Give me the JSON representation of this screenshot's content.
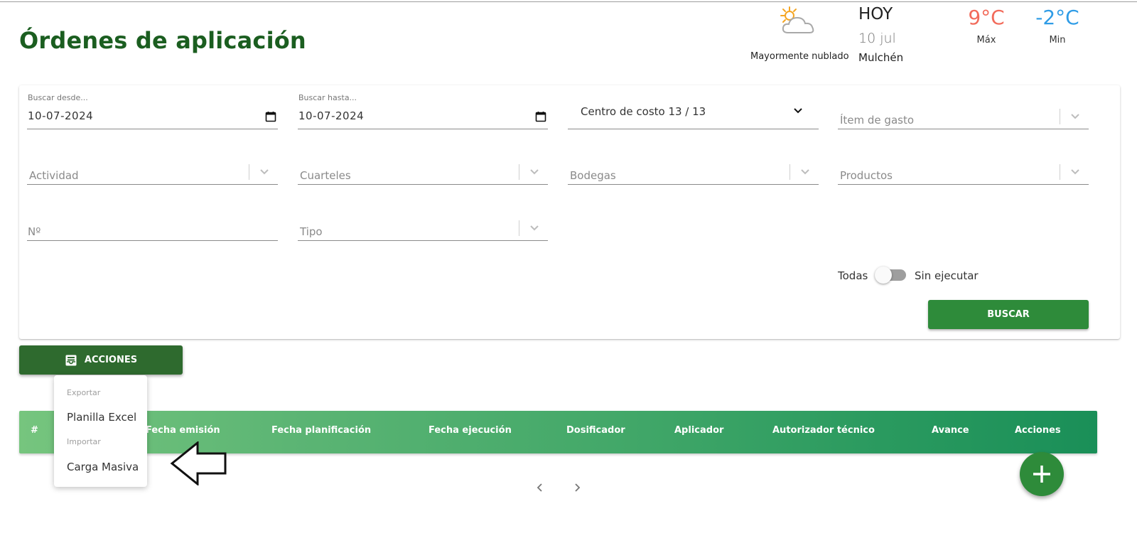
{
  "page": {
    "title": "Órdenes de aplicación"
  },
  "weather": {
    "icon": "partly-cloudy-icon",
    "description": "Mayormente nublado",
    "today": "HOY",
    "date": "10 jul",
    "city": "Mulchén",
    "max_temp": "9°C",
    "max_label": "Máx",
    "min_temp": "-2°C",
    "min_label": "Min",
    "max_color": "#f26b5b",
    "min_color": "#2f9ce6"
  },
  "filters": {
    "date_from": {
      "label": "Buscar desde...",
      "value": "10-07-2024"
    },
    "date_to": {
      "label": "Buscar hasta...",
      "value": "10-07-2024"
    },
    "cost_center": {
      "value": "Centro de costo 13 / 13"
    },
    "expense_item": {
      "placeholder": "Ítem de gasto"
    },
    "activity": {
      "placeholder": "Actividad"
    },
    "quarters": {
      "placeholder": "Cuarteles"
    },
    "warehouses": {
      "placeholder": "Bodegas"
    },
    "products": {
      "placeholder": "Productos"
    },
    "number": {
      "placeholder": "Nº"
    },
    "type": {
      "placeholder": "Tipo"
    },
    "toggle": {
      "left_label": "Todas",
      "right_label": "Sin ejecutar",
      "on": false
    },
    "search_button": "BUSCAR"
  },
  "actions": {
    "button_label": "ACCIONES",
    "menu": {
      "export_header": "Exportar",
      "export_item": "Planilla Excel",
      "import_header": "Importar",
      "import_item": "Carga Masiva"
    }
  },
  "table": {
    "columns": [
      "#",
      "Fecha emisión",
      "Fecha planificación",
      "Fecha ejecución",
      "Dosificador",
      "Aplicador",
      "Autorizador técnico",
      "Avance",
      "Acciones"
    ]
  },
  "colors": {
    "title": "#1b5e20",
    "primary_button": "#2e8b3a",
    "actions_button": "#2e6a2e",
    "header_gradient_start": "#76c57e",
    "header_gradient_end": "#1a8f58"
  }
}
